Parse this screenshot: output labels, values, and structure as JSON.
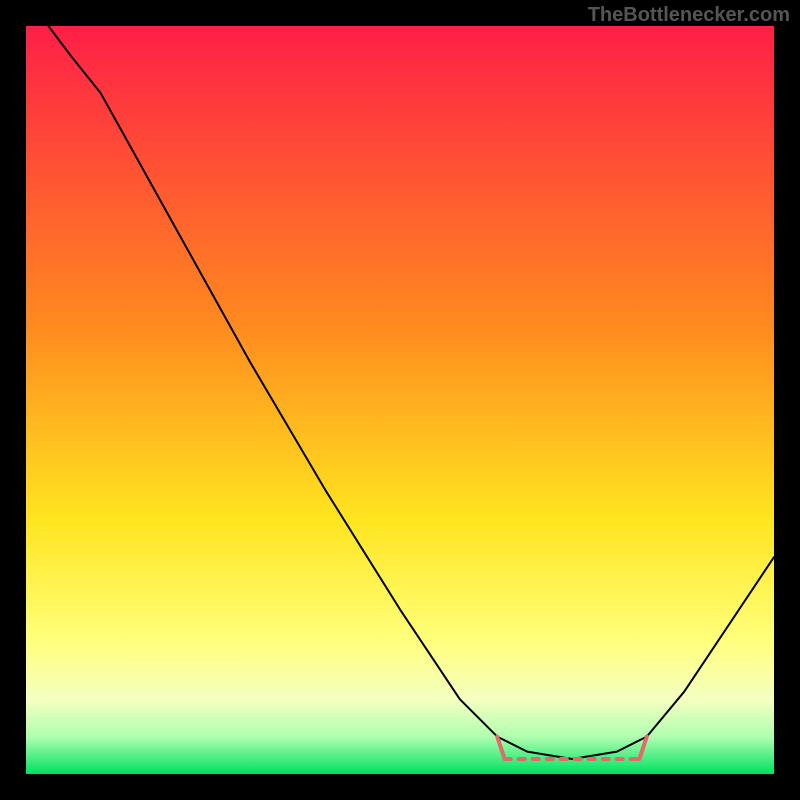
{
  "watermark": "TheBottlenecker.com",
  "chart_data": {
    "type": "line",
    "title": "",
    "xlabel": "",
    "ylabel": "",
    "xlim": [
      0,
      100
    ],
    "ylim": [
      0,
      100
    ],
    "gradient_stops": [
      {
        "offset": 0,
        "color": "#ff1f47"
      },
      {
        "offset": 40,
        "color": "#ff8a1f"
      },
      {
        "offset": 66,
        "color": "#ffe51f"
      },
      {
        "offset": 82,
        "color": "#ffff7a"
      },
      {
        "offset": 90,
        "color": "#f4ffc0"
      },
      {
        "offset": 95,
        "color": "#b0ffb0"
      },
      {
        "offset": 100,
        "color": "#00e060"
      }
    ],
    "series": [
      {
        "name": "bottleneck-curve",
        "color": "#000000",
        "width": 2,
        "points": [
          {
            "x": 3,
            "y": 100
          },
          {
            "x": 6,
            "y": 96
          },
          {
            "x": 10,
            "y": 91
          },
          {
            "x": 15,
            "y": 82
          },
          {
            "x": 20,
            "y": 73
          },
          {
            "x": 30,
            "y": 55
          },
          {
            "x": 40,
            "y": 38
          },
          {
            "x": 50,
            "y": 22
          },
          {
            "x": 58,
            "y": 10
          },
          {
            "x": 63,
            "y": 5
          },
          {
            "x": 67,
            "y": 3
          },
          {
            "x": 73,
            "y": 2
          },
          {
            "x": 79,
            "y": 3
          },
          {
            "x": 83,
            "y": 5
          },
          {
            "x": 88,
            "y": 11
          },
          {
            "x": 94,
            "y": 20
          },
          {
            "x": 100,
            "y": 29
          }
        ]
      },
      {
        "name": "optimal-range-vertical-left",
        "color": "#e36a6a",
        "width": 4,
        "points": [
          {
            "x": 63,
            "y": 5
          },
          {
            "x": 64,
            "y": 2
          }
        ]
      },
      {
        "name": "optimal-range-horizontal",
        "color": "#e36a6a",
        "width": 4,
        "dash": true,
        "points": [
          {
            "x": 64,
            "y": 2
          },
          {
            "x": 82,
            "y": 2
          }
        ]
      },
      {
        "name": "optimal-range-vertical-right",
        "color": "#e36a6a",
        "width": 4,
        "points": [
          {
            "x": 82,
            "y": 2
          },
          {
            "x": 83,
            "y": 5
          }
        ]
      }
    ]
  }
}
